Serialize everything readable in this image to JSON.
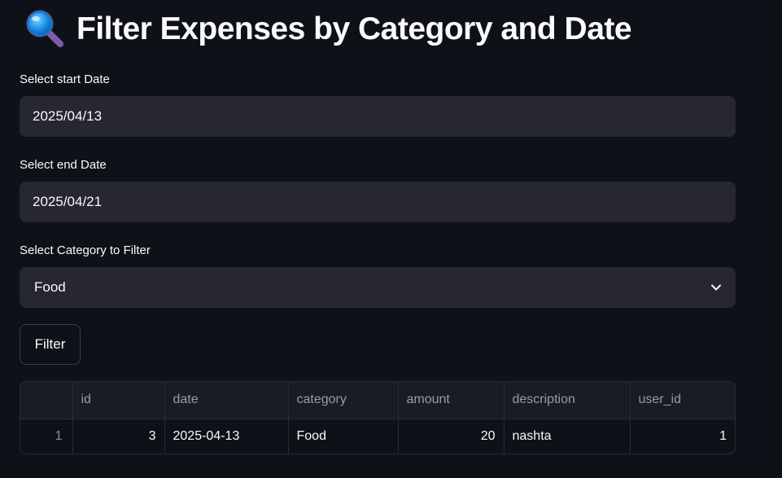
{
  "page": {
    "title": "Filter Expenses by Category and Date",
    "title_icon": "magnifying-glass-icon"
  },
  "form": {
    "start_label": "Select start Date",
    "start_value": "2025/04/13",
    "end_label": "Select end Date",
    "end_value": "2025/04/21",
    "category_label": "Select Category to Filter",
    "category_value": "Food",
    "filter_button": "Filter"
  },
  "table": {
    "columns": [
      "",
      "id",
      "date",
      "category",
      "amount",
      "description",
      "user_id"
    ],
    "rows": [
      {
        "index": "1",
        "id": "3",
        "date": "2025-04-13",
        "category": "Food",
        "amount": "20",
        "description": "nashta",
        "user_id": "1"
      }
    ]
  },
  "colors": {
    "background": "#0e1117",
    "input_bg": "#262730",
    "text": "#fafafa",
    "header_text": "#9a9ca5"
  }
}
